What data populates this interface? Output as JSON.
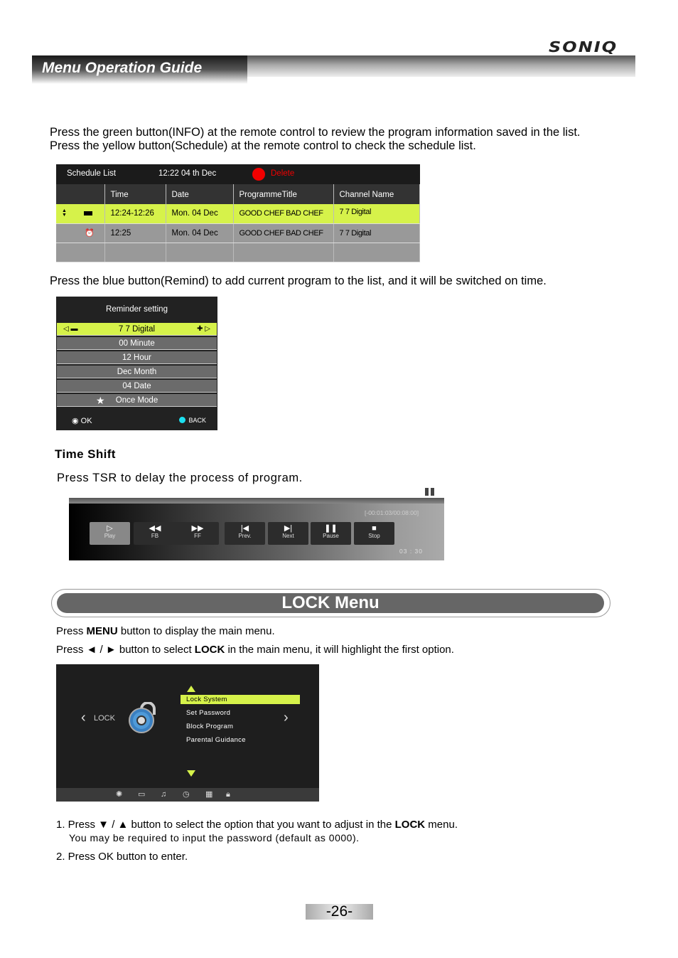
{
  "header": {
    "brand": "SONIQ",
    "title": "Menu Operation Guide"
  },
  "intro_text": "Press the green button(INFO) at the remote control to review the program information saved in the list. Press the yellow button(Schedule) at the remote control to check the schedule list.",
  "schedule_list": {
    "title": "Schedule List",
    "datetime": "12:22  04 th Dec",
    "delete_label": "Delete",
    "delete_color": "#f10000",
    "columns": [
      "",
      "Time",
      "Date",
      "ProgrammeTitle",
      "Channel Name"
    ],
    "rows": [
      {
        "icon": "record-camera-icon",
        "time": "12:24-12:26",
        "date": "Mon. 04 Dec",
        "title": "GOOD CHEF BAD CHEF",
        "channel": "7 7 Digital",
        "selected": true
      },
      {
        "icon": "alarm-clock-icon",
        "time": "12:25",
        "date": "Mon. 04 Dec",
        "title": "GOOD CHEF BAD CHEF",
        "channel": "7 7 Digital",
        "selected": false
      }
    ]
  },
  "remind_text": "Press the blue button(Remind) to add current program to the list, and it will be switched on time.",
  "reminder": {
    "title": "Reminder setting",
    "rows": [
      "7 7 Digital",
      "00 Minute",
      "12 Hour",
      "Dec Month",
      "04 Date",
      "Once Mode"
    ],
    "ok_label": "OK",
    "back_label": "BACK",
    "highlight_color": "#d6f24a"
  },
  "time_shift": {
    "heading": "Time Shift",
    "text": "Press TSR to delay the process of program.",
    "time_readout": "[-00:01:03/00:08:00]",
    "clock": "03 : 30",
    "buttons": [
      "Play",
      "FB",
      "FF",
      "Prev.",
      "Next",
      "Pause",
      "Stop"
    ]
  },
  "lock_section": {
    "banner": "LOCK  Menu",
    "line1_pre": "Press ",
    "line1_bold": "MENU",
    "line1_post": " button to display the main menu.",
    "line2_pre": "Press ◄ / ► button to select ",
    "line2_bold": "LOCK",
    "line2_post": " in the main menu, it will highlight the first option."
  },
  "lock_screen": {
    "label": "LOCK",
    "options": [
      "Lock System",
      "Set Password",
      "Block Program",
      "Parental Guidance"
    ],
    "bottom_icons": [
      "settings-gear-icon",
      "tv-icon",
      "music-icon",
      "clock-icon",
      "apps-grid-icon",
      "lock-icon"
    ]
  },
  "steps": {
    "s1_pre": "1. Press ▼ / ▲ button to select the option that you want to adjust in the ",
    "s1_bold": "LOCK",
    "s1_post": " menu.",
    "s1_note": "You may be required to input the password (default as 0000).",
    "s2": "2. Press  OK button to enter."
  },
  "page_number": "-26-"
}
